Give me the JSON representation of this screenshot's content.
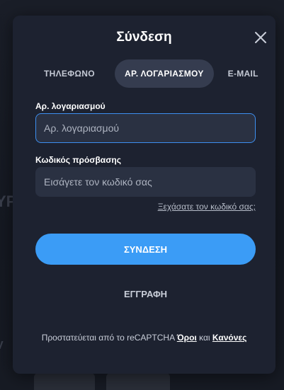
{
  "modal": {
    "title": "Σύνδεση",
    "close_icon": "close-icon"
  },
  "tabs": [
    {
      "label": "ΤΗΛΕΦΩΝΟ",
      "active": false
    },
    {
      "label": "ΑΡ. ΛΟΓΑΡΙΑΣΜΟΥ",
      "active": true
    },
    {
      "label": "E-MAIL",
      "active": false
    }
  ],
  "account_field": {
    "label": "Αρ. λογαριασμού",
    "value": "",
    "placeholder": "Αρ. λογαριασμού"
  },
  "password_field": {
    "label": "Κωδικός πρόσβασης",
    "value": "",
    "placeholder": "Εισάγετε τον κωδικό σας"
  },
  "forgot_link": "Ξεχάσατε τον κωδικό σας;",
  "login_button": "ΣΥΝΔΕΣΗ",
  "register_button": "ΕΓΓΡΑΦΗ",
  "recaptcha": {
    "text": "Προστατεύεται από το reCAPTCHA",
    "terms": "Όροι",
    "and": "και",
    "rules": "Κανόνες"
  },
  "colors": {
    "accent": "#3b9cf6",
    "modal_bg": "#1d2230",
    "input_bg": "#2a3142",
    "focus_border": "#3d8ff0"
  }
}
